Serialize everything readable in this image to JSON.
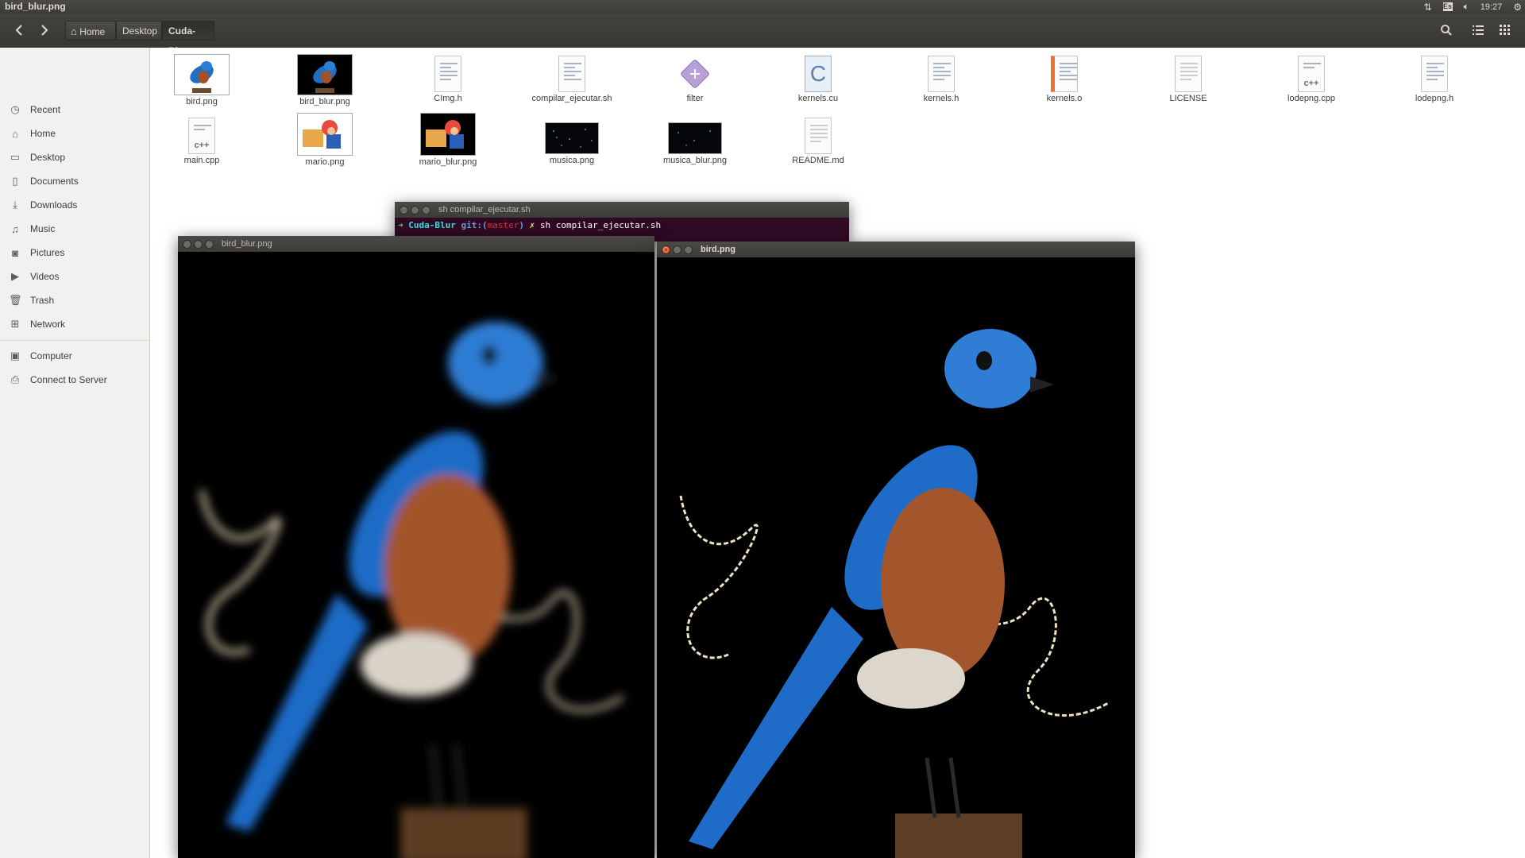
{
  "top_panel": {
    "title": "bird_blur.png",
    "keyboard_layout": "Es",
    "time": "19:27"
  },
  "nautilus": {
    "breadcrumbs": [
      "Home",
      "Desktop",
      "Cuda-Blur"
    ],
    "sidebar": [
      {
        "label": "Recent",
        "icon": "clock-icon"
      },
      {
        "label": "Home",
        "icon": "home-icon"
      },
      {
        "label": "Desktop",
        "icon": "folder-icon"
      },
      {
        "label": "Documents",
        "icon": "document-icon"
      },
      {
        "label": "Downloads",
        "icon": "download-icon"
      },
      {
        "label": "Music",
        "icon": "music-icon"
      },
      {
        "label": "Pictures",
        "icon": "camera-icon"
      },
      {
        "label": "Videos",
        "icon": "video-icon"
      },
      {
        "label": "Trash",
        "icon": "trash-icon"
      },
      {
        "label": "Network",
        "icon": "network-icon"
      },
      {
        "label": "Computer",
        "icon": "computer-icon"
      },
      {
        "label": "Connect to Server",
        "icon": "server-icon"
      }
    ],
    "files": [
      {
        "name": "bird.png",
        "kind": "image-bird"
      },
      {
        "name": "bird_blur.png",
        "kind": "image-bird-dark"
      },
      {
        "name": "CImg.h",
        "kind": "text"
      },
      {
        "name": "compilar_ejecutar.sh",
        "kind": "script"
      },
      {
        "name": "filter",
        "kind": "executable"
      },
      {
        "name": "kernels.cu",
        "kind": "c-source"
      },
      {
        "name": "kernels.h",
        "kind": "text"
      },
      {
        "name": "kernels.o",
        "kind": "object"
      },
      {
        "name": "LICENSE",
        "kind": "plain"
      },
      {
        "name": "lodepng.cpp",
        "kind": "cpp"
      },
      {
        "name": "lodepng.h",
        "kind": "text"
      },
      {
        "name": "main.cpp",
        "kind": "cpp"
      },
      {
        "name": "mario.png",
        "kind": "image-mario"
      },
      {
        "name": "mario_blur.png",
        "kind": "image-mario-dark"
      },
      {
        "name": "musica.png",
        "kind": "image-dark"
      },
      {
        "name": "musica_blur.png",
        "kind": "image-dark"
      },
      {
        "name": "README.md",
        "kind": "plain"
      }
    ]
  },
  "terminal": {
    "title": "sh compilar_ejecutar.sh",
    "prompt_arrow": "➜",
    "prompt_dir": "Cuda-Blur",
    "prompt_git": "git:(",
    "prompt_branch": "master",
    "prompt_git_close": ")",
    "prompt_mark": "✗",
    "command": "sh compilar_ejecutar.sh"
  },
  "viewer_blur": {
    "title": "bird_blur.png"
  },
  "viewer_orig": {
    "title": "bird.png"
  }
}
